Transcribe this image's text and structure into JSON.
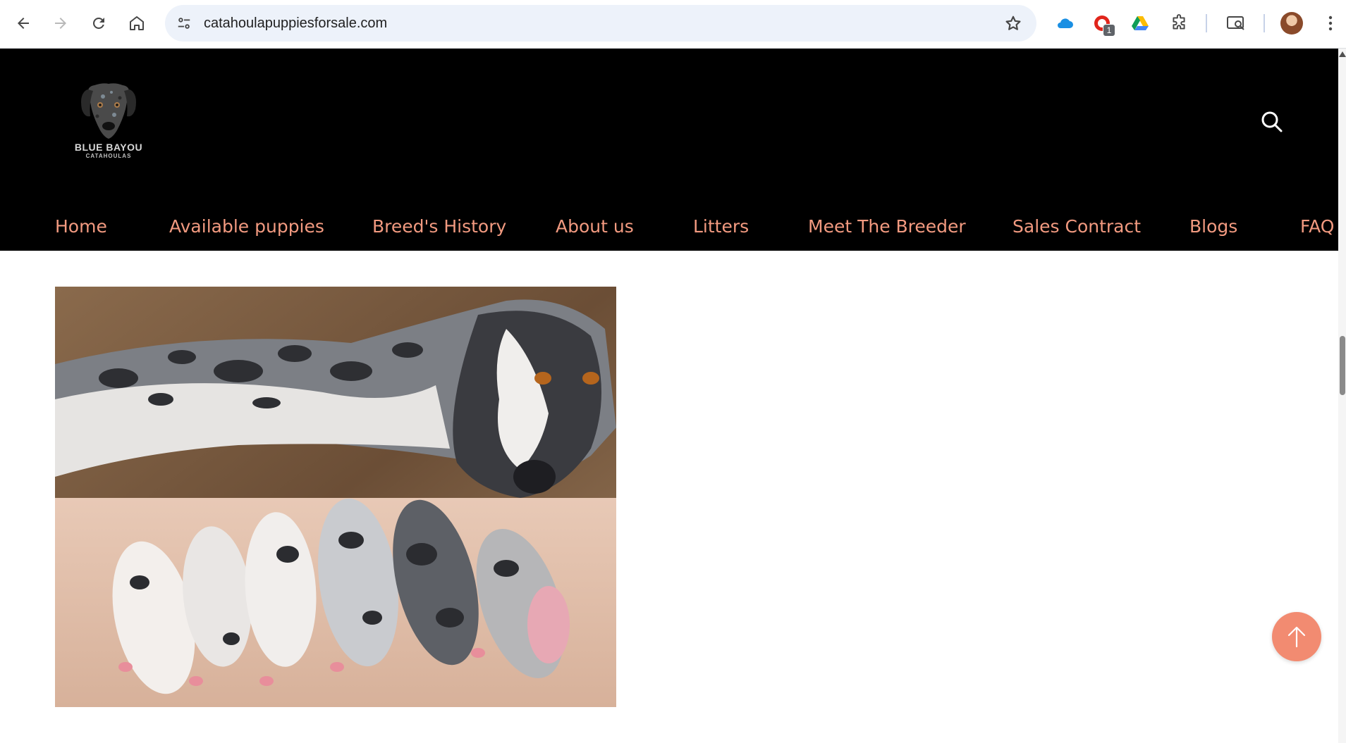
{
  "browser": {
    "url": "catahoulapuppiesforsale.com",
    "extension_badge": "1",
    "icons": [
      "back-icon",
      "forward-icon",
      "reload-icon",
      "home-icon",
      "site-info-icon",
      "star-icon",
      "cloud-icon",
      "pdf-icon",
      "drive-icon",
      "puzzle-icon",
      "reading-list-icon",
      "avatar",
      "menu-dots-icon"
    ]
  },
  "site": {
    "logo_title": "BLUE BAYOU",
    "logo_subtitle": "CATAHOULAS",
    "menu": [
      {
        "label": "Home"
      },
      {
        "label": "Available puppies"
      },
      {
        "label": "Breed's History"
      },
      {
        "label": "About us"
      },
      {
        "label": "Litters"
      },
      {
        "label": "Meet The Breeder"
      },
      {
        "label": "Sales Contract"
      },
      {
        "label": "Blogs"
      },
      {
        "label": "FAQ"
      }
    ],
    "colors": {
      "header_bg": "#000000",
      "menu_text": "#f29a80",
      "accent": "#f28b71"
    }
  }
}
